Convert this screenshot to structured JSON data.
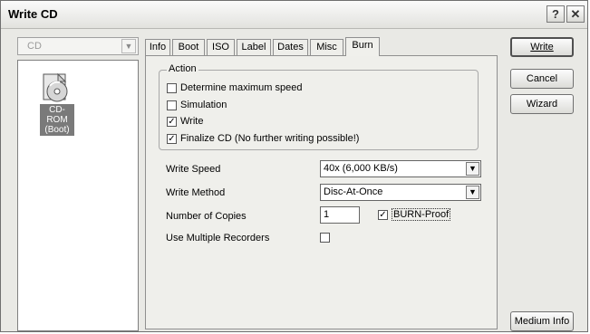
{
  "window": {
    "title": "Write CD",
    "help_label": "?",
    "close_label": "✕"
  },
  "left": {
    "drive_combo": "CD",
    "device": {
      "line1": "CD-ROM",
      "line2": "(Boot)",
      "icon": "cd-rom-icon"
    }
  },
  "tabs": [
    "Info",
    "Boot",
    "ISO",
    "Label",
    "Dates",
    "Misc",
    "Burn"
  ],
  "active_tab": "Burn",
  "action": {
    "title": "Action",
    "items": [
      {
        "label": "Determine maximum speed",
        "checked": false
      },
      {
        "label": "Simulation",
        "checked": false
      },
      {
        "label": "Write",
        "checked": true
      },
      {
        "label": "Finalize CD (No further writing possible!)",
        "checked": true
      }
    ]
  },
  "settings": {
    "write_speed_label": "Write Speed",
    "write_speed_value": "40x (6,000 KB/s)",
    "write_method_label": "Write Method",
    "write_method_value": "Disc-At-Once",
    "copies_label": "Number of Copies",
    "copies_value": "1",
    "burnproof_label": "BURN-Proof",
    "burnproof_checked": true,
    "multi_label": "Use Multiple Recorders",
    "multi_checked": false
  },
  "buttons": {
    "write": "Write",
    "cancel": "Cancel",
    "wizard": "Wizard",
    "medium_info": "Medium Info"
  }
}
